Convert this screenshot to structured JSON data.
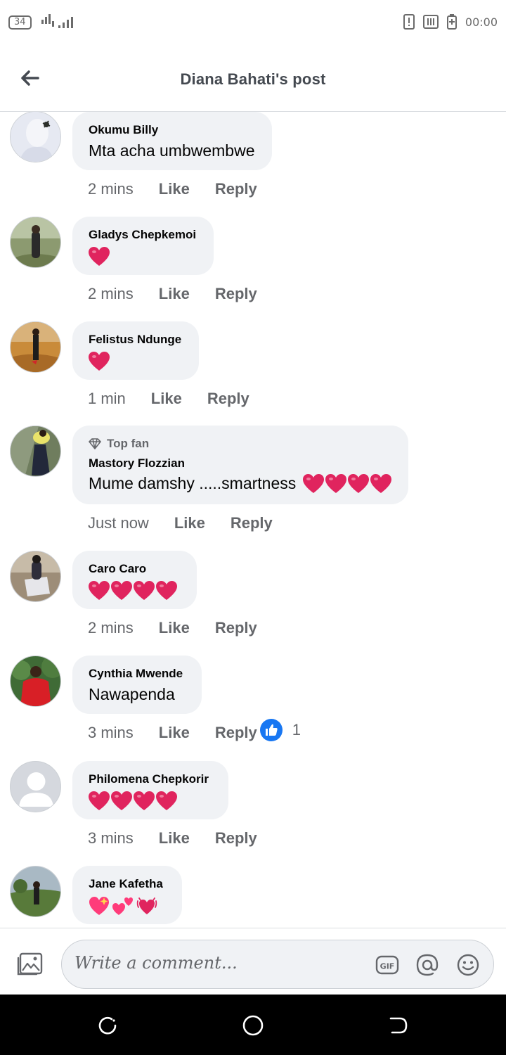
{
  "status_bar": {
    "badge": "34",
    "time": "00:00"
  },
  "header": {
    "title": "Diana  Bahati's post",
    "back_icon": "arrow-left-icon"
  },
  "comments": [
    {
      "author": "Okumu Billy",
      "text": "Mta acha umbwembwe",
      "hearts": 0,
      "time": "2 mins",
      "like": "Like",
      "reply": "Reply"
    },
    {
      "author": "Gladys Chepkemoi",
      "text": "",
      "hearts": 1,
      "time": "2 mins",
      "like": "Like",
      "reply": "Reply"
    },
    {
      "author": "Felistus Ndunge",
      "text": "",
      "hearts": 1,
      "time": "1 min",
      "like": "Like",
      "reply": "Reply"
    },
    {
      "badge": "Top fan",
      "author": "Mastory Flozzian",
      "text": "Mume damshy .....smartness",
      "hearts": 4,
      "time": "Just now",
      "like": "Like",
      "reply": "Reply"
    },
    {
      "author": "Caro Caro",
      "text": "",
      "hearts": 4,
      "time": "2 mins",
      "like": "Like",
      "reply": "Reply"
    },
    {
      "author": "Cynthia Mwende",
      "text": "Nawapenda",
      "hearts": 0,
      "time": "3 mins",
      "like": "Like",
      "reply": "Reply",
      "reaction_count": "1"
    },
    {
      "author": "Philomena Chepkorir",
      "text": "",
      "hearts": 4,
      "time": "3 mins",
      "like": "Like",
      "reply": "Reply"
    },
    {
      "author": "Jane Kafetha",
      "text": "",
      "emoji": [
        "sparkling-heart",
        "two-hearts",
        "beating-heart"
      ]
    }
  ],
  "composer": {
    "placeholder": "Write a comment...",
    "icons": [
      "photo-icon",
      "gif-icon",
      "mention-icon",
      "emoji-icon"
    ]
  },
  "colors": {
    "bubble": "#f0f2f5",
    "heart": "#e0245e",
    "like_blue": "#1877f2",
    "secondary_text": "#65676b"
  }
}
